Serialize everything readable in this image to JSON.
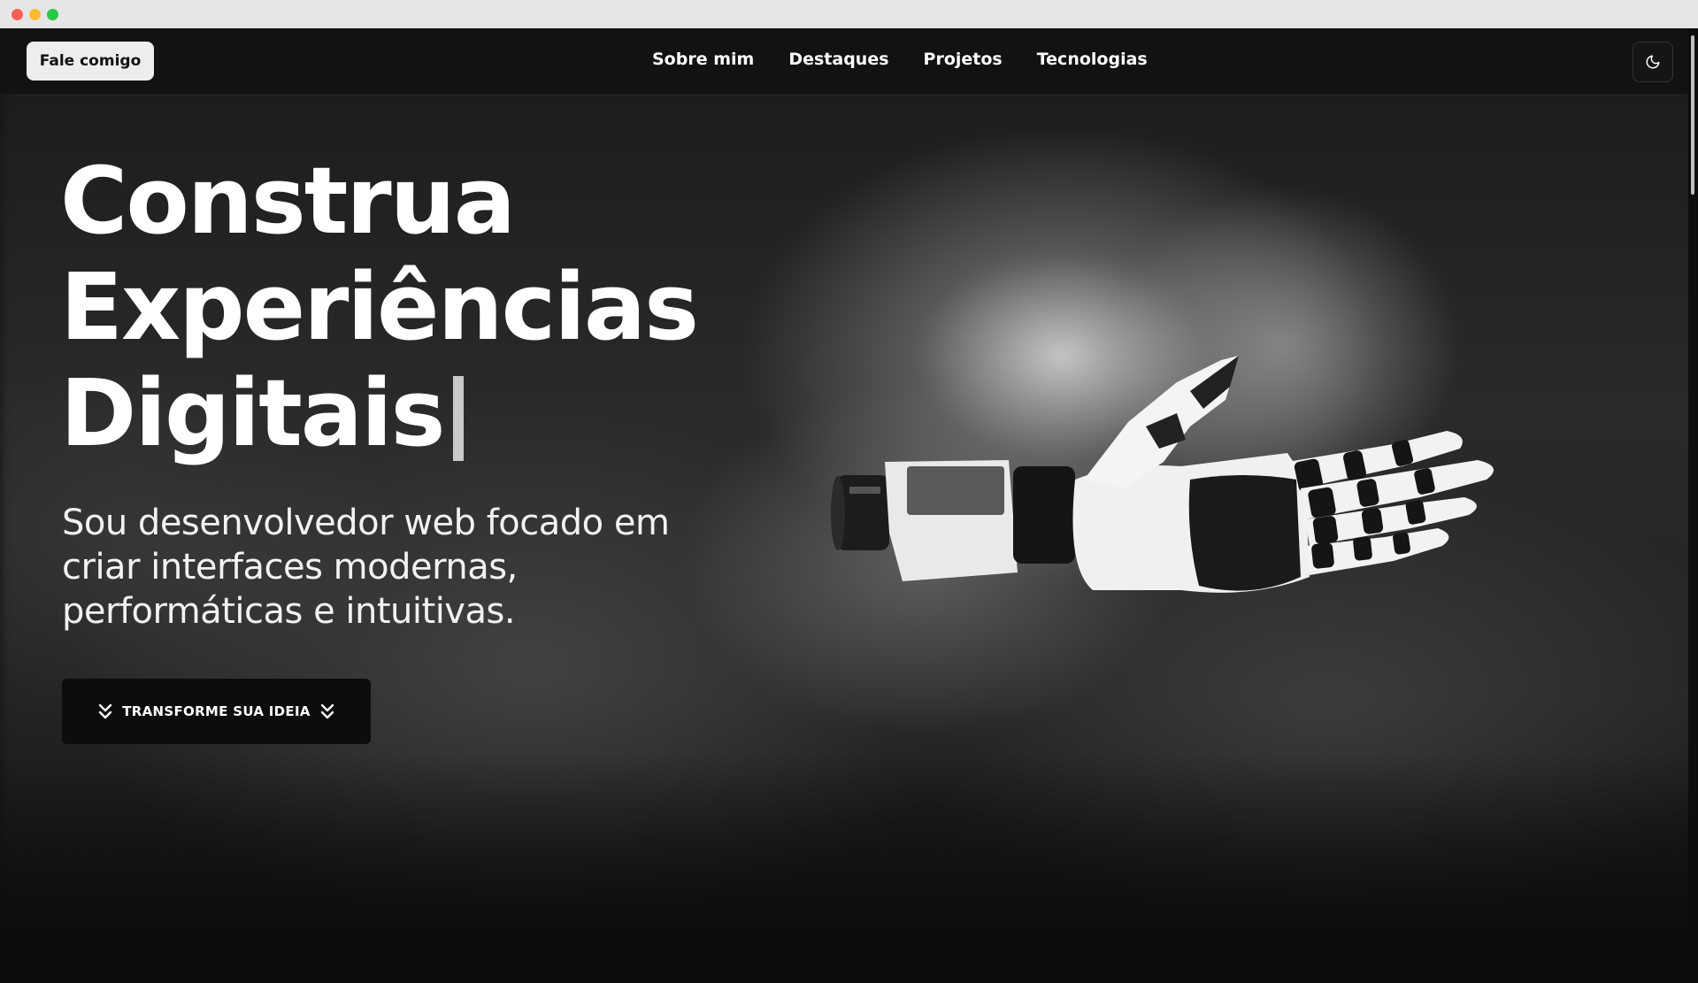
{
  "nav": {
    "contact_label": "Fale comigo",
    "links": [
      {
        "label": "Sobre mim"
      },
      {
        "label": "Destaques"
      },
      {
        "label": "Projetos"
      },
      {
        "label": "Tecnologias"
      }
    ],
    "theme_toggle_icon": "moon-icon"
  },
  "hero": {
    "title_lines": [
      "Construa",
      "Experiências",
      "Digitais"
    ],
    "subtitle": "Sou desenvolvedor web focado em criar interfaces modernas, performáticas e intuitivas.",
    "cta_label": "TRANSFORME SUA IDEIA",
    "cta_icon": "double-chevron-down-icon",
    "illustration": "robotic-hand"
  },
  "colors": {
    "background": "#121212",
    "text": "#ffffff",
    "contact_button": "#ededed",
    "cta_button": "#0d0d0d"
  }
}
